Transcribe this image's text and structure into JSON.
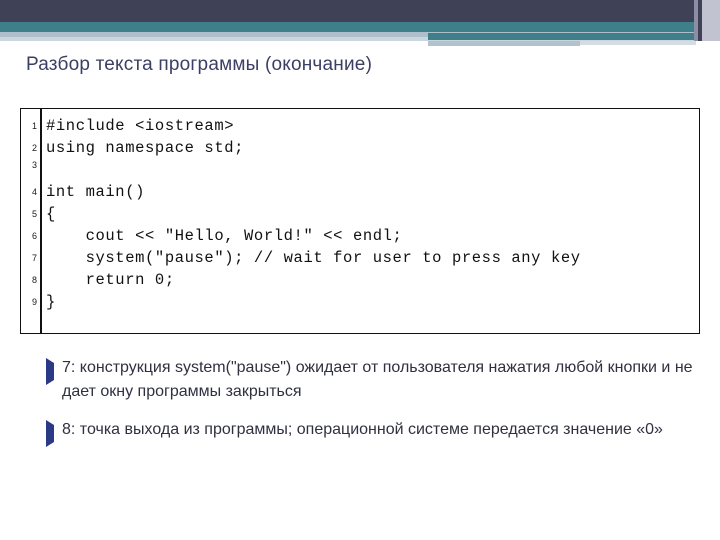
{
  "slide": {
    "title": "Разбор текста программы (окончание)",
    "theme": {
      "banner_dark": "#3f4256",
      "banner_teal": "#3e7f8a",
      "banner_light": "#aebecb",
      "title_color": "#3b3f63",
      "bullet_marker_color": "#2b3a86",
      "code_border": "#111111"
    }
  },
  "code": {
    "language": "C++",
    "lines": [
      {
        "number": "1",
        "text": "#include <iostream>"
      },
      {
        "number": "2",
        "text": "using namespace std;"
      },
      {
        "number": "3",
        "text": ""
      },
      {
        "number": "4",
        "text": "int main()"
      },
      {
        "number": "5",
        "text": "{"
      },
      {
        "number": "6",
        "text": "    cout << \"Hello, World!\" << endl;"
      },
      {
        "number": "7",
        "text": "    system(\"pause\"); // wait for user to press any key"
      },
      {
        "number": "8",
        "text": "    return 0;"
      },
      {
        "number": "9",
        "text": "}"
      }
    ]
  },
  "bullets": [
    {
      "marker": "triangle-bullet-icon",
      "text": "7: конструкция system(\"pause\") ожидает от пользователя нажатия любой кнопки и не дает окну программы закрыться"
    },
    {
      "marker": "triangle-bullet-icon",
      "text": "8: точка выхода из программы; операционной системе передается значение «0»"
    }
  ]
}
